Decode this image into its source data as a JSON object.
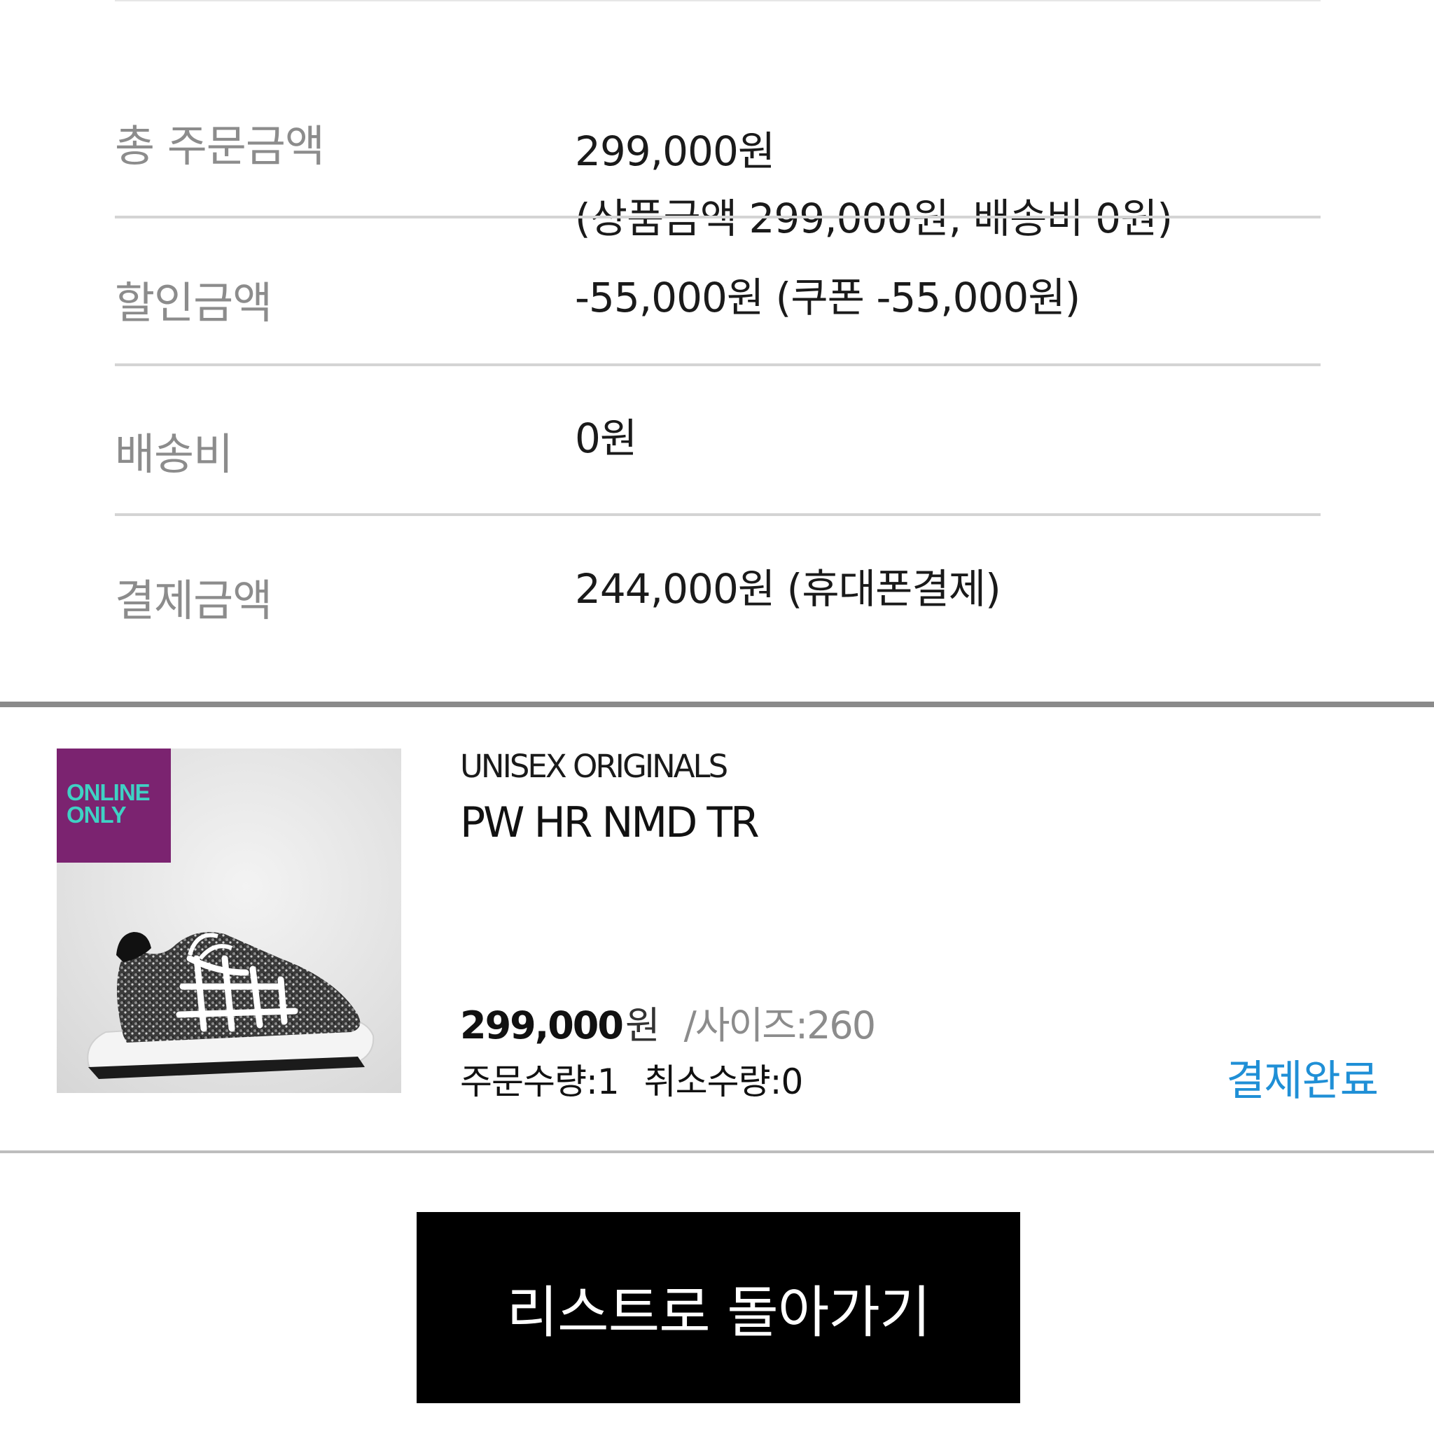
{
  "summary": {
    "total_order": {
      "label": "총 주문금액",
      "value_line1": "299,000원",
      "value_line2": "(상품금액 299,000원, 배송비 0원)"
    },
    "discount": {
      "label": "할인금액",
      "value": "-55,000원 (쿠폰 -55,000원)"
    },
    "shipping": {
      "label": "배송비",
      "value": "0원"
    },
    "payment": {
      "label": "결제금액",
      "value": "244,000원 (휴대폰결제)"
    }
  },
  "product": {
    "badge_line1": "ONLINE",
    "badge_line2": "ONLY",
    "category": "UNISEX ORIGINALS",
    "name": "PW HR NMD TR",
    "price": "299,000",
    "price_unit": "원",
    "size_label": "/사이즈:260",
    "order_qty": "주문수량:1",
    "cancel_qty": "취소수량:0",
    "status": "결제완료",
    "image_alt": "sneaker-image",
    "colors": {
      "badge_bg": "#7b2370",
      "badge_text": "#3fd1c4",
      "status": "#1f8fd6"
    }
  },
  "back_button": {
    "label": "리스트로 돌아가기"
  }
}
